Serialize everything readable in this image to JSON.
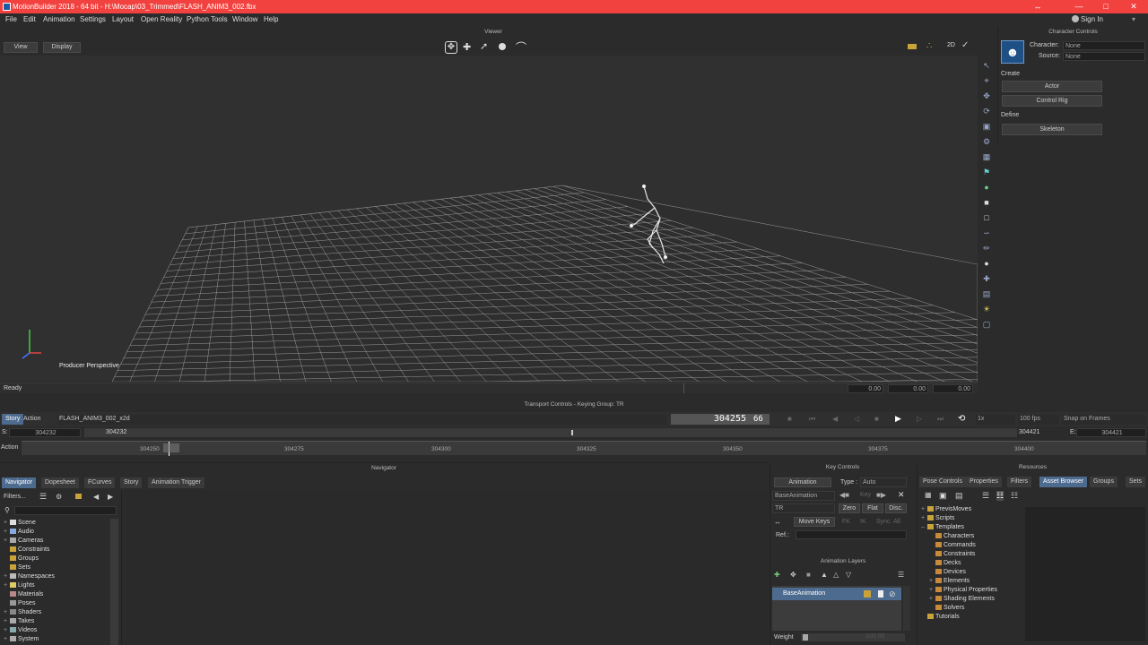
{
  "window": {
    "title": "MotionBuilder 2018 - 64 bit - H:\\Mocap\\03_Trimmed\\FLASH_ANIM3_002.fbx",
    "minimize": "—",
    "maximize": "□",
    "close": "✕"
  },
  "menu": {
    "items": [
      "File",
      "Edit",
      "Animation",
      "Settings",
      "Layout",
      "Open Reality",
      "Python Tools",
      "Window",
      "Help"
    ],
    "sign_in": "Sign In"
  },
  "viewer": {
    "header": "Viewer",
    "view_label": "View",
    "display_label": "Display",
    "camera_label": "Producer Perspective",
    "status": "Ready",
    "mode_label": "2D",
    "status_fields": [
      "0.00",
      "0.00",
      "0.00"
    ]
  },
  "character_controls": {
    "header": "Character Controls",
    "character_label": "Character:",
    "character_value": "None",
    "source_label": "Source:",
    "source_value": "None",
    "create_label": "Create",
    "actor_button": "Actor",
    "control_rig_button": "Control Rig",
    "define_label": "Define",
    "skeleton_button": "Skeleton"
  },
  "transport": {
    "header": "Transport Controls  -  Keying Group: TR",
    "story_label": "Story",
    "action_label": "Action",
    "take_name": "FLASH_ANIM3_002_x2d",
    "timecode": "304255",
    "frame_suffix": "66",
    "speed": "1x",
    "fps": "100 fps",
    "snap": "Snap on Frames",
    "start_label": "S:",
    "start_value": "304232",
    "start_value_2": "304232",
    "end_label": "E:",
    "end_value": "304421",
    "end_value_2": "304421",
    "action_row_label": "Action",
    "ticks": [
      "304250",
      "304275",
      "304300",
      "304325",
      "304350",
      "304375",
      "304400"
    ]
  },
  "navigator": {
    "header": "Navigator",
    "tabs": [
      "Navigator",
      "Dopesheet",
      "FCurves",
      "Story",
      "Animation Trigger"
    ],
    "filters_label": "Filters...",
    "tree": [
      "Scene",
      "Audio",
      "Cameras",
      "Constraints",
      "Groups",
      "Sets",
      "Namespaces",
      "Lights",
      "Materials",
      "Poses",
      "Shaders",
      "Takes",
      "Videos",
      "System"
    ]
  },
  "key_controls": {
    "header": "Key Controls",
    "animation_label": "Animation",
    "type_label": "Type :",
    "type_value": "Auto",
    "layer_value": "BaseAnimation",
    "key_label": "Key",
    "tr_value": "TR",
    "zero_label": "Zero",
    "flat_label": "Flat",
    "disc_label": "Disc.",
    "move_keys_label": "Move Keys",
    "fk_label": "FK",
    "ik_label": "IK",
    "sync_label": "Sync. All",
    "ref_label": "Ref.:",
    "layers_header": "Animation Layers",
    "layer_row": "BaseAnimation",
    "weight_label": "Weight",
    "weight_value": "100.00"
  },
  "resources": {
    "header": "Resources",
    "tabs": [
      "Pose Controls",
      "Properties",
      "Filters",
      "Asset Browser",
      "Groups",
      "Sets"
    ],
    "tree": [
      {
        "label": "PrevisMoves",
        "indent": 0,
        "plus": true
      },
      {
        "label": "Scripts",
        "indent": 0,
        "plus": true
      },
      {
        "label": "Templates",
        "indent": 0,
        "plus": false
      },
      {
        "label": "Characters",
        "indent": 1,
        "plus": false
      },
      {
        "label": "Commands",
        "indent": 1,
        "plus": false
      },
      {
        "label": "Constraints",
        "indent": 1,
        "plus": false
      },
      {
        "label": "Decks",
        "indent": 1,
        "plus": false
      },
      {
        "label": "Devices",
        "indent": 1,
        "plus": false
      },
      {
        "label": "Elements",
        "indent": 1,
        "plus": true
      },
      {
        "label": "Physical Properties",
        "indent": 1,
        "plus": true
      },
      {
        "label": "Shading Elements",
        "indent": 1,
        "plus": true
      },
      {
        "label": "Solvers",
        "indent": 1,
        "plus": false
      },
      {
        "label": "Tutorials",
        "indent": 0,
        "plus": false
      }
    ]
  },
  "colors": {
    "title_bar": "#f2423f",
    "active_tab": "#4d6b8f",
    "panel": "#2b2b2b",
    "viewport": "#303030",
    "folder": "#c9a23a"
  }
}
